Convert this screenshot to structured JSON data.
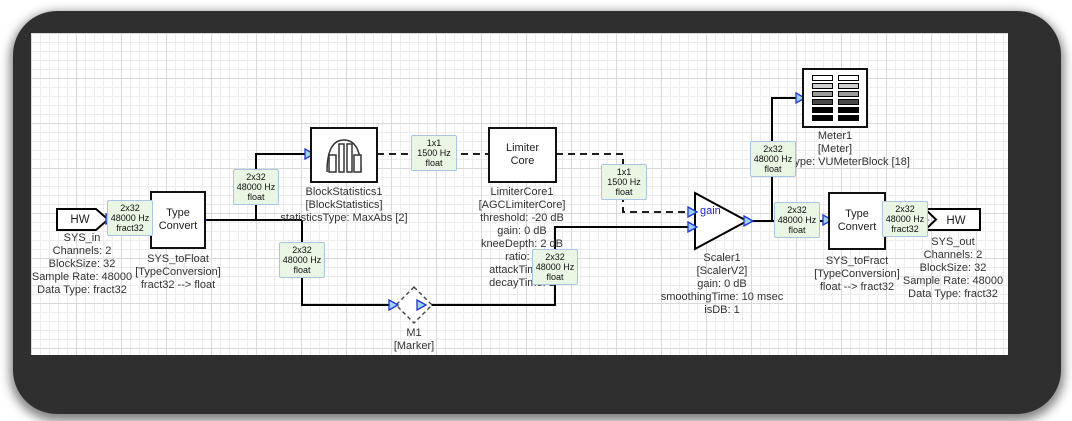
{
  "blocks": {
    "sys_in": {
      "shape_label": "HW",
      "name": "SYS_in",
      "props": [
        "Channels: 2",
        "BlockSize: 32",
        "Sample Rate: 48000",
        "Data Type: fract32"
      ]
    },
    "sys_to_float": {
      "title": "Type Convert",
      "name": "SYS_toFloat",
      "props": [
        "[TypeConversion]",
        "fract32 --> float"
      ]
    },
    "block_statistics": {
      "name": "BlockStatistics1",
      "props": [
        "[BlockStatistics]",
        "statisticsType: MaxAbs [2]"
      ]
    },
    "limiter_core": {
      "title": "Limiter Core",
      "name": "LimiterCore1",
      "props": [
        "[AGCLimiterCore]",
        "threshold: -20 dB",
        "gain: 0 dB",
        "kneeDepth: 2 dB",
        "ratio: 4",
        "attackTime: 2",
        "decayTime: 1"
      ]
    },
    "marker": {
      "name": "M1",
      "props": [
        "[Marker]"
      ]
    },
    "scaler": {
      "gain_pin": "gain",
      "name": "Scaler1",
      "props": [
        "[ScalerV2]",
        "gain: 0 dB",
        "smoothingTime: 10 msec",
        "isDB: 1"
      ]
    },
    "meter": {
      "name": "Meter1",
      "props": [
        "[Meter]",
        "meterType: VUMeterBlock [18]"
      ]
    },
    "sys_to_fract": {
      "title": "Type Convert",
      "name": "SYS_toFract",
      "props": [
        "[TypeConversion]",
        "float --> fract32"
      ]
    },
    "sys_out": {
      "shape_label": "HW",
      "name": "SYS_out",
      "props": [
        "Channels: 2",
        "BlockSize: 32",
        "Sample Rate: 48000",
        "Data Type: fract32"
      ]
    }
  },
  "wire_labels": [
    {
      "lines": [
        "2x32",
        "48000 Hz",
        "fract32"
      ]
    },
    {
      "lines": [
        "2x32",
        "48000 Hz",
        "float"
      ]
    },
    {
      "lines": [
        "2x32",
        "48000 Hz",
        "float"
      ]
    },
    {
      "lines": [
        "1x1",
        "1500 Hz",
        "float"
      ]
    },
    {
      "lines": [
        "1x1",
        "1500 Hz",
        "float"
      ]
    },
    {
      "lines": [
        "2x32",
        "48000 Hz",
        "float"
      ]
    },
    {
      "lines": [
        "2x32",
        "48000 Hz",
        "float"
      ]
    },
    {
      "lines": [
        "2x32",
        "48000 Hz",
        "float"
      ]
    },
    {
      "lines": [
        "2x32",
        "48000 Hz",
        "fract32"
      ]
    }
  ],
  "colors": {
    "wire_label_bg": "#e9f6e3",
    "wire_label_border": "#a9c5df",
    "pin_stroke": "#2233dd",
    "pin_fill": "#9bd4f5",
    "gain_text": "#2222dd",
    "frame": "#2f2f2f",
    "meter_bar_colors": [
      "#ffffff",
      "#d0d0d0",
      "#9a9a9a",
      "#4a4a4a",
      "#000000",
      "#000000"
    ]
  }
}
